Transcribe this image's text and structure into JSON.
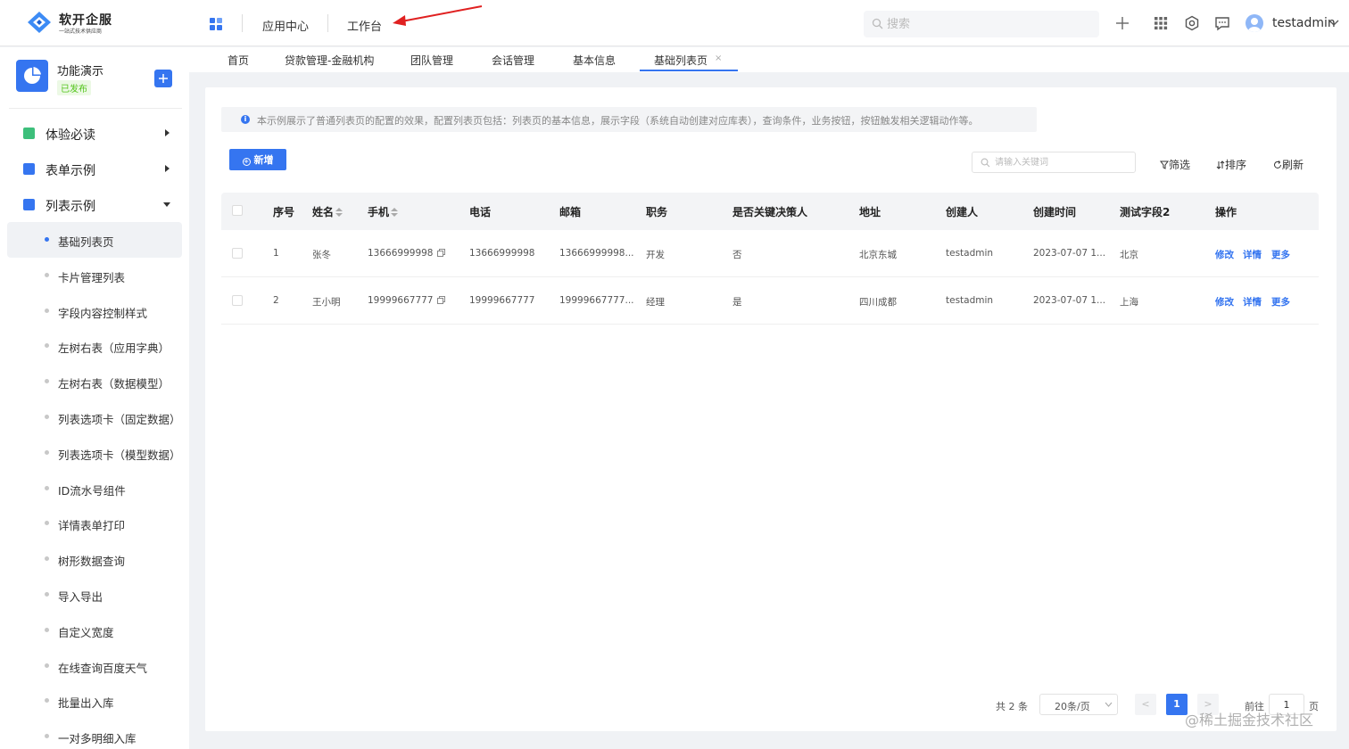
{
  "header": {
    "logo_title": "软开企服",
    "logo_subtitle": "一站式技术供应商",
    "nav": [
      "应用中心",
      "工作台"
    ],
    "search_placeholder": "搜索",
    "username": "testadmin",
    "icons": [
      "app-grid-icon",
      "plus-icon",
      "apps-icon",
      "gear-icon",
      "message-icon",
      "avatar",
      "chevron-down-icon"
    ]
  },
  "sidebar": {
    "app_name": "功能演示",
    "app_status": "已发布",
    "groups": [
      {
        "label": "体验必读",
        "color": "#3dbf7b",
        "expanded": false
      },
      {
        "label": "表单示例",
        "color": "#3575f0",
        "expanded": false
      },
      {
        "label": "列表示例",
        "color": "#3575f0",
        "expanded": true
      }
    ],
    "items": [
      "基础列表页",
      "卡片管理列表",
      "字段内容控制样式",
      "左树右表（应用字典）",
      "左树右表（数据模型）",
      "列表选项卡（固定数据）",
      "列表选项卡（模型数据）",
      "ID流水号组件",
      "详情表单打印",
      "树形数据查询",
      "导入导出",
      "自定义宽度",
      "在线查询百度天气",
      "批量出入库",
      "一对多明细入库"
    ],
    "active_item": "基础列表页"
  },
  "tabs": [
    "首页",
    "贷款管理-金融机构",
    "团队管理",
    "会话管理",
    "基本信息",
    "基础列表页"
  ],
  "tab_close": "×",
  "info": "本示例展示了普通列表页的配置的效果，配置列表页包括：列表页的基本信息，展示字段（系统自动创建对应库表），查询条件，业务按钮，按钮触发相关逻辑动作等。",
  "info_icon": "i",
  "toolbar": {
    "add_label": "新增",
    "add_icon": "+",
    "keyword_placeholder": "请输入关键词",
    "filter_label": "筛选",
    "sort_label": "排序",
    "refresh_label": "刷新"
  },
  "table": {
    "headers": [
      "序号",
      "姓名",
      "手机",
      "电话",
      "邮箱",
      "职务",
      "是否关键决策人",
      "地址",
      "创建人",
      "创建时间",
      "测试字段2",
      "操作"
    ],
    "rows": [
      {
        "no": "1",
        "name": "张冬",
        "mobile": "13666999998",
        "phone": "13666999998",
        "email": "13666999998...",
        "title": "开发",
        "key": "否",
        "addr": "北京东城",
        "creator": "testadmin",
        "created": "2023-07-07 1...",
        "f2": "北京"
      },
      {
        "no": "2",
        "name": "王小明",
        "mobile": "19999667777",
        "phone": "19999667777",
        "email": "19999667777...",
        "title": "经理",
        "key": "是",
        "addr": "四川成都",
        "creator": "testadmin",
        "created": "2023-07-07 1...",
        "f2": "上海"
      }
    ],
    "actions": [
      "修改",
      "详情",
      "更多"
    ]
  },
  "pagination": {
    "total": "共 2 条",
    "page_size": "20条/页",
    "prev": "<",
    "next": ">",
    "current": "1",
    "goto_label": "前往",
    "goto_value": "1",
    "page_unit": "页"
  },
  "watermark": "@稀土掘金技术社区",
  "colors": {
    "primary": "#3575f0",
    "success": "#52c41a",
    "annotation_arrow": "#e02020"
  }
}
